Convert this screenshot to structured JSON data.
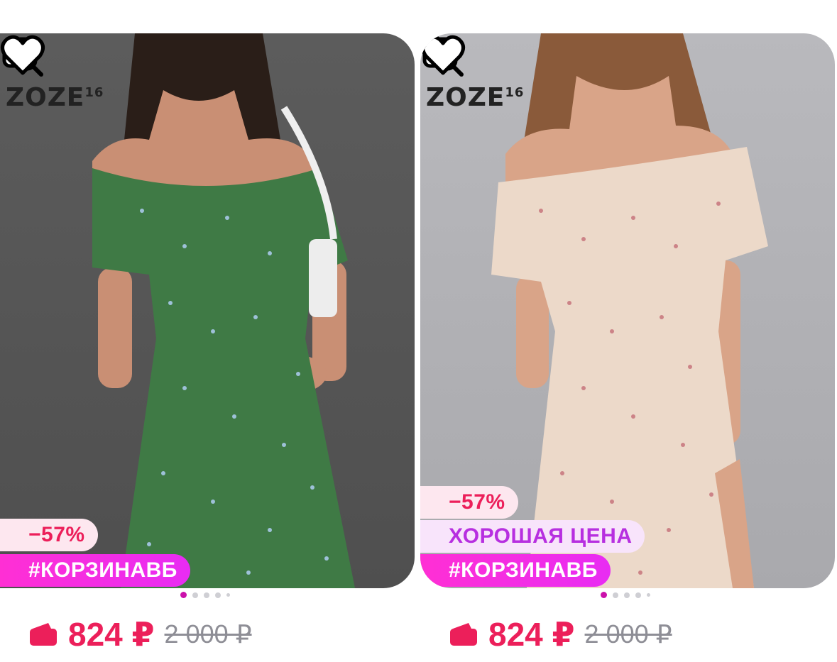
{
  "products": [
    {
      "brand": "ZOZE",
      "brand_sup": "16",
      "discount": "−57%",
      "label": "",
      "tag": "#КОРЗИНАВБ",
      "price": "824 ₽",
      "old_price": "2 000 ₽",
      "dress_color": "#3f7a45"
    },
    {
      "brand": "ZOZE",
      "brand_sup": "16",
      "discount": "−57%",
      "label": "ХОРОШАЯ ЦЕНА",
      "tag": "#КОРЗИНАВБ",
      "price": "824 ₽",
      "old_price": "2 000 ₽",
      "dress_color": "#ecd9c9"
    }
  ],
  "colors": {
    "accent": "#ec1f5a",
    "tag": "#ff2fe0",
    "good_price": "#b72fe0"
  },
  "icons": [
    "image-search-icon",
    "heart-icon",
    "wallet-icon"
  ]
}
